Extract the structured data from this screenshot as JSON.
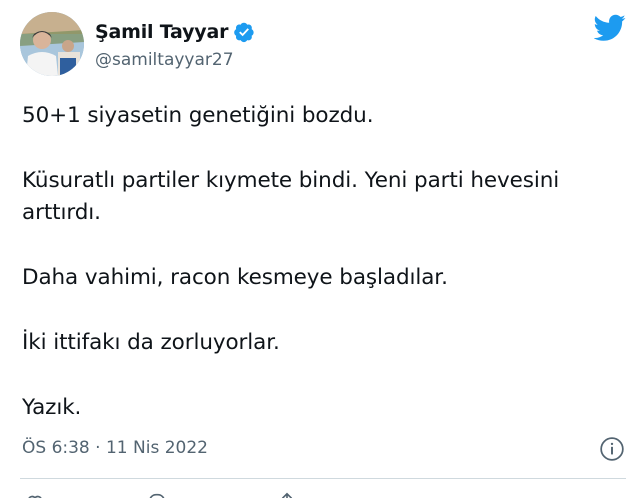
{
  "user": {
    "display_name": "Şamil Tayyar",
    "handle": "@samiltayyar27",
    "avatar_icon": "profile-photo",
    "verified_icon": "verified-badge-icon"
  },
  "tweet": {
    "paragraphs": [
      "50+1 siyasetin genetiğini bozdu.",
      "Küsuratlı partiler kıymete bindi. Yeni parti hevesini arttırdı.",
      "Daha vahimi, racon kesmeye başladılar.",
      "İki ittifakı da zorluyorlar.",
      "Yazık."
    ],
    "timestamp": "ÖS 6:38 · 11 Nis 2022"
  },
  "icons": {
    "brand": "twitter-bird-icon",
    "info": "info-icon",
    "actions": [
      "heart-icon",
      "reply-icon",
      "share-icon"
    ]
  },
  "colors": {
    "brand_blue": "#1d9bf0",
    "text_primary": "#0f1419",
    "text_secondary": "#536471",
    "divider": "#cfd9de"
  }
}
